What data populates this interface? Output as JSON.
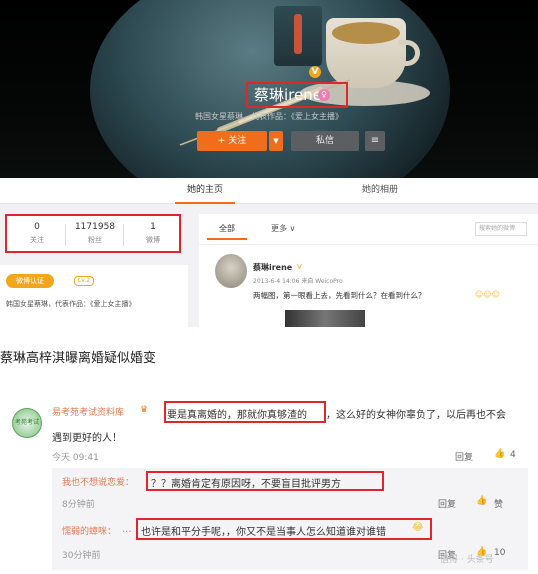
{
  "profile": {
    "name": "蔡琳irene",
    "verified_badge": "V",
    "gender_icon": "female-icon",
    "description": "韩国女星蔡琳，代表作品：《爱上女主播》",
    "follow_label": "+ 关注",
    "dropdown_label": "▼",
    "message_label": "私信",
    "menu_label": "≡"
  },
  "tabs": {
    "home": "她的主页",
    "album": "她的相册"
  },
  "stats": {
    "following": {
      "value": "0",
      "label": "关注"
    },
    "fans": {
      "value": "1171958",
      "label": "粉丝"
    },
    "posts": {
      "value": "1",
      "label": "微博"
    }
  },
  "left_card": {
    "verify_label": "微博认证",
    "level_label": "Lv.2",
    "description": "韩国女星蔡琳，代表作品：《爱上女主播》"
  },
  "feed": {
    "tab_all": "全部",
    "tab_more": "更多 ∨",
    "search_placeholder": "搜索她的微博",
    "post": {
      "name": "蔡琳irene",
      "verified_badge": "V",
      "meta": "2013-6-4 14:06 来自 WeicoPro",
      "text": "两幅图，第一眼看上去，先看到什么？在看到什么？"
    }
  },
  "headline": "蔡琳高梓淇曝离婚疑似婚变",
  "comments": {
    "main": {
      "avatar_text": "考苑考试",
      "author": "易考苑考试资料库",
      "text_line1_boxed": "要是真离婚的，那就你真够渣的",
      "text_line1_rest": "，这么好的女神你辜负了，以后再也不会",
      "text_line2": "遇到更好的人！",
      "time": "今天 09:41",
      "reply_label": "回复",
      "like_count": "4"
    },
    "replies": [
      {
        "author": "我也不想说恋爱：",
        "text": "？？离婚肯定有原因呀，不要盲目批评男方",
        "time": "8分钟前",
        "reply_label": "回复",
        "like_label": "赞"
      },
      {
        "author": "懦弱的蟑咪：",
        "text_prefix": "...",
        "text": "也许是和平分手呢，，你又不是当事人怎么知道谁对谁错",
        "time": "30分钟前",
        "reply_label": "回复",
        "like_count": "10"
      }
    ]
  },
  "watermark": "值得 · 头条号"
}
